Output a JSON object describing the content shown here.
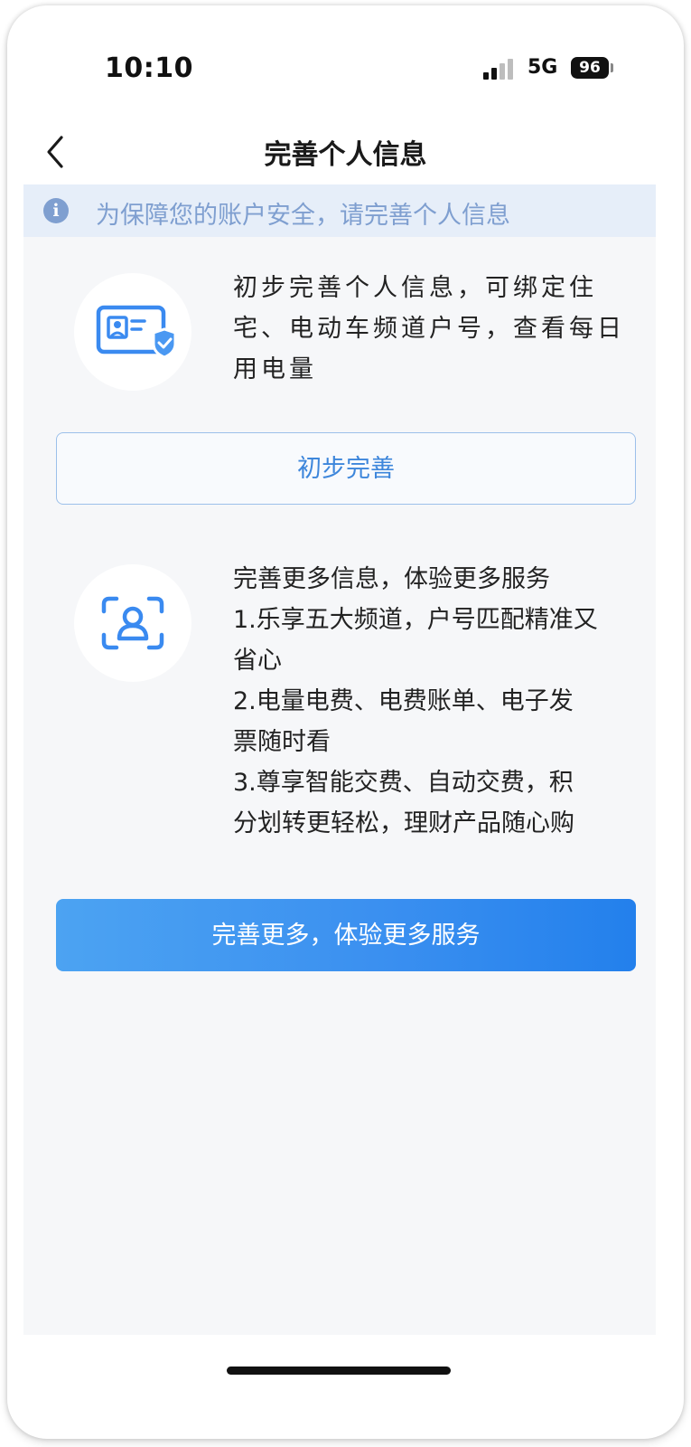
{
  "status_bar": {
    "time": "10:10",
    "network": "5G",
    "battery": "96"
  },
  "nav": {
    "title": "完善个人信息",
    "back_icon": "chevron-left-icon"
  },
  "notice": {
    "icon": "info-icon",
    "icon_glyph": "i",
    "text": "为保障您的账户安全，请完善个人信息"
  },
  "basic": {
    "icon": "id-card-shield-icon",
    "lines": [
      "初步完善个人信息，可绑定住",
      "宅、电动车频道户号，查看每日",
      "用电量"
    ],
    "button_label": "初步完善"
  },
  "advanced": {
    "icon": "face-scan-icon",
    "lines": [
      "完善更多信息，体验更多服务",
      "1.乐享五大频道，户号匹配精准又",
      "省心",
      "2.电量电费、电费账单、电子发",
      "票随时看",
      "3.尊享智能交费、自动交费，积",
      "分划转更轻松，理财产品随心购"
    ],
    "button_label": "完善更多，体验更多服务"
  },
  "colors": {
    "accent": "#3d86db",
    "notice_bg": "#e6eef9",
    "notice_text": "#7f9fd0",
    "page_bg": "#f6f7f9"
  }
}
